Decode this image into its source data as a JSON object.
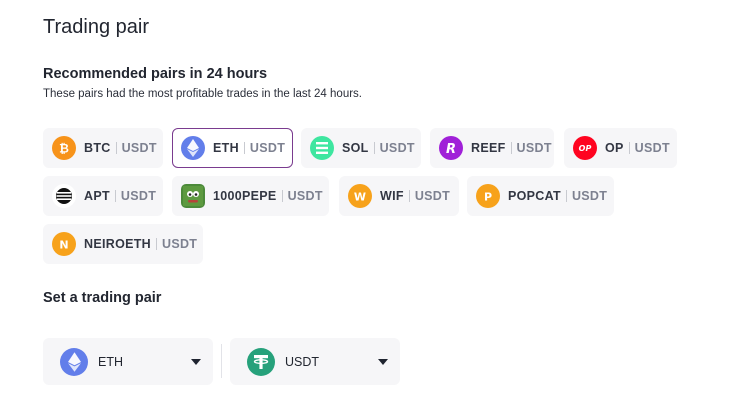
{
  "title": "Trading pair",
  "recommended": {
    "heading": "Recommended pairs in 24 hours",
    "subheading": "These pairs had the most profitable trades in the last 24 hours.",
    "pairs": [
      {
        "base": "BTC",
        "quote": "USDT",
        "icon": "btc-icon",
        "color": "#f7931a"
      },
      {
        "base": "ETH",
        "quote": "USDT",
        "icon": "eth-icon",
        "color": "#627eea",
        "selected": true
      },
      {
        "base": "SOL",
        "quote": "USDT",
        "icon": "sol-icon",
        "color": "#3ee6a0"
      },
      {
        "base": "REEF",
        "quote": "USDT",
        "icon": "reef-icon",
        "color": "#a020d8"
      },
      {
        "base": "OP",
        "quote": "USDT",
        "icon": "op-icon",
        "color": "#ff0420"
      },
      {
        "base": "APT",
        "quote": "USDT",
        "icon": "apt-icon",
        "color": "#111111"
      },
      {
        "base": "1000PEPE",
        "quote": "USDT",
        "icon": "pepe-icon",
        "color": "#4c8a3a"
      },
      {
        "base": "WIF",
        "quote": "USDT",
        "icon": "wif-icon",
        "color": "#f7a21b"
      },
      {
        "base": "POPCAT",
        "quote": "USDT",
        "icon": "popcat-icon",
        "color": "#f7a21b"
      },
      {
        "base": "NEIROETH",
        "quote": "USDT",
        "icon": "neiroeth-icon",
        "color": "#f7a21b"
      }
    ]
  },
  "set_pair": {
    "heading": "Set a trading pair",
    "base_select": {
      "value": "ETH",
      "icon": "eth-icon",
      "color": "#627eea"
    },
    "quote_select": {
      "value": "USDT",
      "icon": "usdt-icon",
      "color": "#26a17b"
    }
  },
  "colors": {
    "selected_border": "#7a3b8f",
    "pill_bg": "#f6f6f8"
  }
}
